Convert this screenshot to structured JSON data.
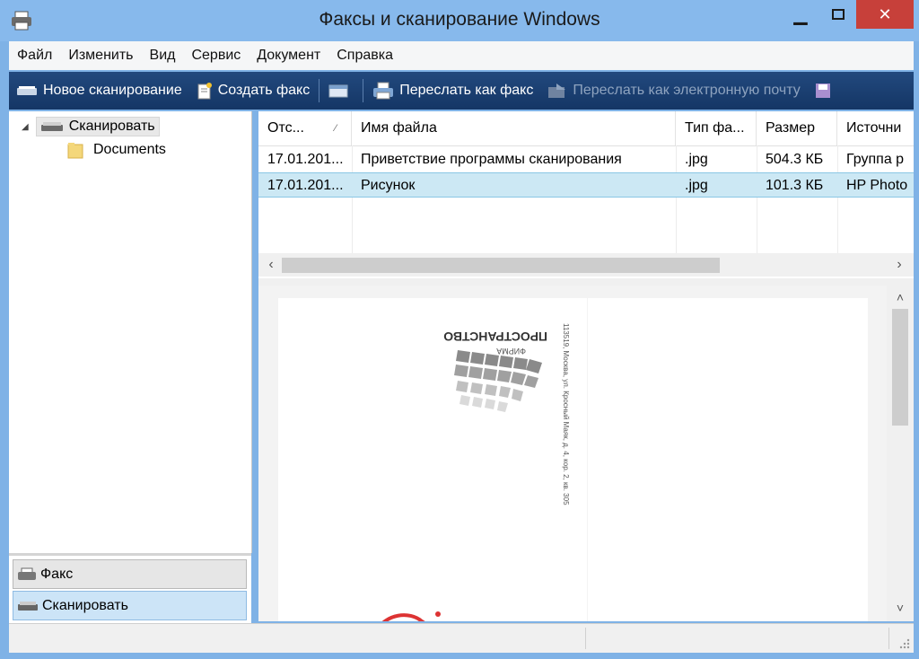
{
  "window": {
    "title": "Факсы и сканирование Windows"
  },
  "menu": [
    "Файл",
    "Изменить",
    "Вид",
    "Сервис",
    "Документ",
    "Справка"
  ],
  "toolbar": {
    "new_scan": "Новое сканирование",
    "new_fax": "Создать факс",
    "forward_fax": "Переслать как факс",
    "forward_email": "Переслать как электронную почту"
  },
  "tree": {
    "root": "Сканировать",
    "child": "Documents"
  },
  "nav": {
    "fax": "Факс",
    "scan": "Сканировать"
  },
  "list": {
    "columns": [
      "Отс...",
      "Имя файла",
      "Тип фа...",
      "Размер",
      "Источни"
    ],
    "rows": [
      {
        "date": "17.01.201...",
        "name": "Приветствие программы сканирования",
        "type": ".jpg",
        "size": "504.3 КБ",
        "source": "Группа р"
      },
      {
        "date": "17.01.201...",
        "name": "Рисунок",
        "type": ".jpg",
        "size": "101.3 КБ",
        "source": "HP Photo"
      }
    ],
    "selected_row": 1
  },
  "preview": {
    "company_heading": "ПРОСТРАНСТВО",
    "company_sub": "ФИРМА",
    "address": "113519, Москва, ул. Кросный Маяк, д. 4, кор. 2, кв. 305"
  }
}
